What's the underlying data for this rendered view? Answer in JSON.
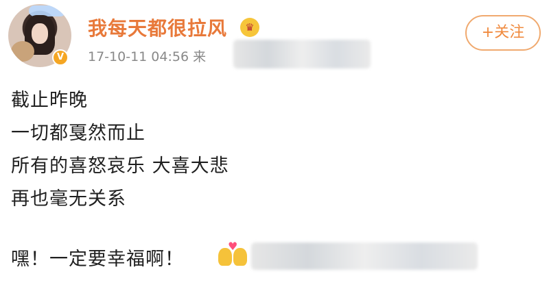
{
  "post": {
    "username": "我每天都很拉风",
    "verified_badge": "V",
    "crown_icon": "crown-icon",
    "meta_time": "17-10-11 04:56",
    "meta_source_prefix": "来",
    "follow_label": "+关注",
    "lines": [
      "截止昨晚",
      "一切都戛然而止",
      "所有的喜怒哀乐 大喜大悲",
      "再也毫无关系",
      "嘿！一定要幸福啊！"
    ],
    "emoji": "couple-with-heart-icon",
    "colors": {
      "username": "#e8793a",
      "follow_border": "#f0a96e",
      "meta": "#888888"
    }
  }
}
